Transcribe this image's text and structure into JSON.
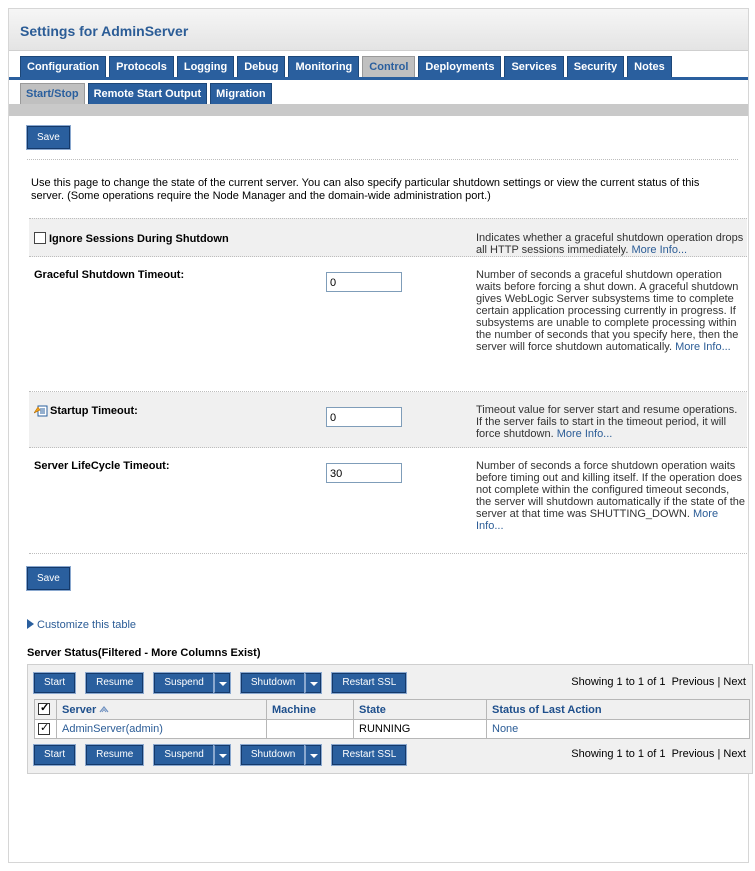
{
  "title": "Settings for AdminServer",
  "tabs": [
    {
      "label": "Configuration",
      "active": false
    },
    {
      "label": "Protocols",
      "active": false
    },
    {
      "label": "Logging",
      "active": false
    },
    {
      "label": "Debug",
      "active": false
    },
    {
      "label": "Monitoring",
      "active": false
    },
    {
      "label": "Control",
      "active": true
    },
    {
      "label": "Deployments",
      "active": false
    },
    {
      "label": "Services",
      "active": false
    },
    {
      "label": "Security",
      "active": false
    },
    {
      "label": "Notes",
      "active": false
    }
  ],
  "subtabs": [
    {
      "label": "Start/Stop",
      "active": true
    },
    {
      "label": "Remote Start Output",
      "active": false
    },
    {
      "label": "Migration",
      "active": false
    }
  ],
  "save_label": "Save",
  "intro": "Use this page to change the state of the current server. You can also specify particular shutdown settings or view the current status of this server. (Some operations require the Node Manager and the domain-wide administration port.)",
  "settings": {
    "ignore_sessions": {
      "label": "Ignore Sessions During Shutdown",
      "checked": false,
      "desc": "Indicates whether a graceful shutdown operation drops all HTTP sessions immediately.",
      "more": "More Info..."
    },
    "graceful_timeout": {
      "label": "Graceful Shutdown Timeout:",
      "value": "0",
      "desc": "Number of seconds a graceful shutdown operation waits before forcing a shut down. A graceful shutdown gives WebLogic Server subsystems time to complete certain application processing currently in progress. If subsystems are unable to complete processing within the number of seconds that you specify here, then the server will force shutdown automatically.",
      "more": "More Info..."
    },
    "startup_timeout": {
      "label": "Startup Timeout:",
      "value": "0",
      "desc": "Timeout value for server start and resume operations. If the server fails to start in the timeout period, it will force shutdown.",
      "more": "More Info..."
    },
    "lifecycle_timeout": {
      "label": "Server LifeCycle Timeout:",
      "value": "30",
      "desc": "Number of seconds a force shutdown operation waits before timing out and killing itself. If the operation does not complete within the configured timeout seconds, the server will shutdown automatically if the state of the server at that time was SHUTTING_DOWN.",
      "more": "More Info..."
    }
  },
  "customize_label": "Customize this table",
  "table_title": "Server Status(Filtered - More Columns Exist)",
  "toolbar": {
    "start": "Start",
    "resume": "Resume",
    "suspend": "Suspend",
    "shutdown": "Shutdown",
    "restart_ssl": "Restart SSL",
    "showing": "Showing 1 to 1 of 1",
    "previous": "Previous",
    "separator": "|",
    "next": "Next"
  },
  "columns": [
    "Server",
    "Machine",
    "State",
    "Status of Last Action"
  ],
  "rows": [
    {
      "checked": true,
      "server": "AdminServer(admin)",
      "machine": "",
      "state": "RUNNING",
      "status": "None"
    }
  ],
  "colors": {
    "accent": "#2a5f9e",
    "link": "#2b5c96",
    "title": "#2b5c96"
  }
}
